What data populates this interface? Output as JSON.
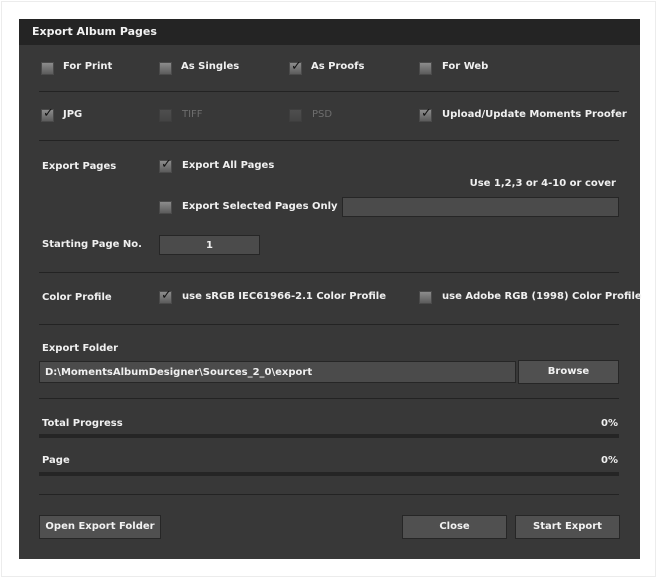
{
  "dialog": {
    "title": "Export Album Pages"
  },
  "export_types": [
    {
      "label": "For Print",
      "checked": false,
      "enabled": true
    },
    {
      "label": "As Singles",
      "checked": false,
      "enabled": true
    },
    {
      "label": "As Proofs",
      "checked": true,
      "enabled": true
    },
    {
      "label": "For Web",
      "checked": false,
      "enabled": true
    }
  ],
  "formats": [
    {
      "label": "JPG",
      "checked": true,
      "enabled": true
    },
    {
      "label": "TIFF",
      "checked": false,
      "enabled": false
    },
    {
      "label": "PSD",
      "checked": false,
      "enabled": false
    },
    {
      "label": "Upload/Update Moments Proofer",
      "checked": true,
      "enabled": true
    }
  ],
  "export_pages": {
    "label": "Export Pages",
    "all_pages": {
      "label": "Export All Pages",
      "checked": true
    },
    "hint": "Use 1,2,3 or 4-10 or cover",
    "selected_pages": {
      "label": "Export Selected Pages Only",
      "checked": false
    },
    "selected_pages_value": "",
    "starting_page_label": "Starting Page No.",
    "starting_page_value": "1"
  },
  "color_profile": {
    "label": "Color Profile",
    "srgb": {
      "label": "use sRGB IEC61966-2.1 Color Profile",
      "checked": true
    },
    "adobe": {
      "label": "use Adobe RGB (1998) Color Profile",
      "checked": false
    }
  },
  "export_folder": {
    "label": "Export Folder",
    "path": "D:\\MomentsAlbumDesigner\\Sources_2_0\\export",
    "browse_label": "Browse"
  },
  "progress": {
    "total": {
      "label": "Total Progress",
      "percent_text": "0%",
      "value": 0
    },
    "page": {
      "label": "Page",
      "percent_text": "0%",
      "value": 0
    }
  },
  "buttons": {
    "open_folder": "Open Export Folder",
    "close": "Close",
    "start": "Start Export"
  },
  "glyphs": {
    "check": "✓"
  }
}
